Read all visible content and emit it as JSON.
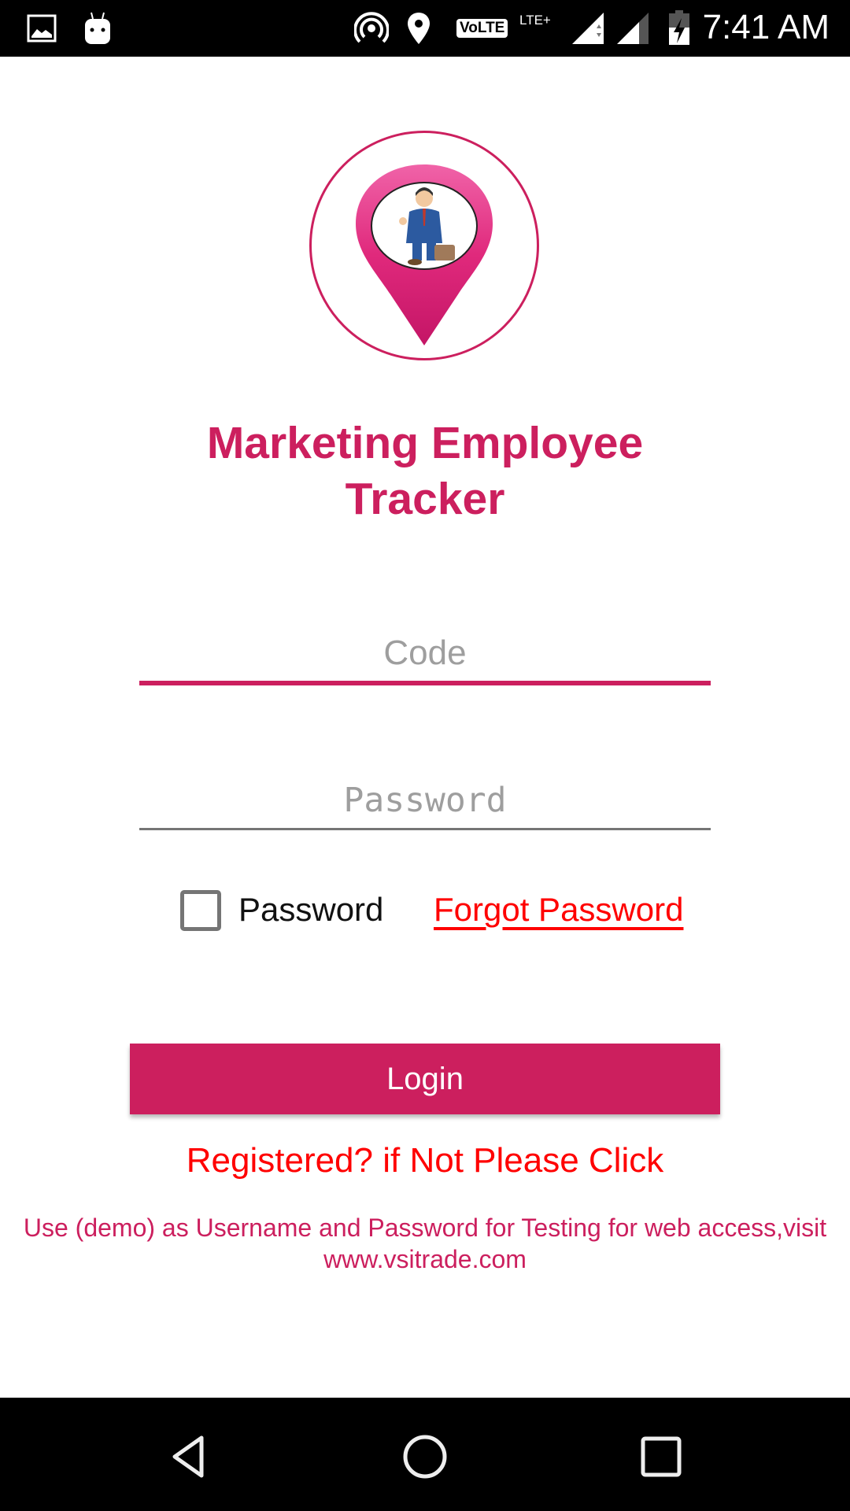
{
  "status_bar": {
    "time": "7:41 AM",
    "volte_label": "VoLTE",
    "network_label": "LTE+",
    "icons": [
      "gallery-icon",
      "android-icon",
      "hotspot-icon",
      "location-icon",
      "volte-icon",
      "signal-icon",
      "signal-icon",
      "battery-charging-icon"
    ]
  },
  "app": {
    "logo": "employee-location-pin-logo",
    "title_line1": "Marketing Employee",
    "title_line2": "Tracker",
    "accent_color": "#cc1f5e"
  },
  "form": {
    "code_placeholder": "Code",
    "code_value": "",
    "password_placeholder": "Password",
    "password_value": "",
    "show_password_label": "Password",
    "show_password_checked": false,
    "forgot_password_label": "Forgot Password",
    "login_label": "Login",
    "register_label": "Registered? if Not Please Click"
  },
  "footer": {
    "note_line1": "Use (demo) as Username and Password for Testing for web access,visit",
    "note_line2": "www.vsitrade.com"
  },
  "nav_bar": {
    "buttons": [
      "back",
      "home",
      "recents"
    ]
  }
}
